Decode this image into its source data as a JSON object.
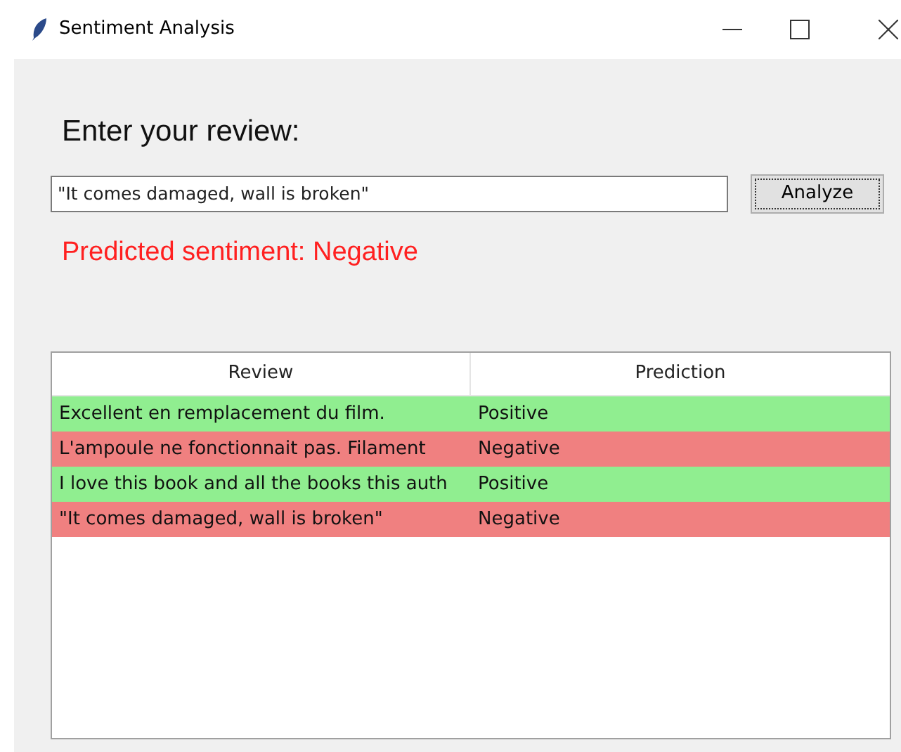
{
  "window": {
    "title": "Sentiment Analysis"
  },
  "prompt": "Enter your review:",
  "review_field": {
    "value": "\"It comes damaged, wall is broken\""
  },
  "analyze_button": "Analyze",
  "result": {
    "text": "Predicted sentiment: Negative",
    "color": "#ff2020"
  },
  "table": {
    "columns": [
      "Review",
      "Prediction"
    ],
    "rows": [
      {
        "cells": [
          "Excellent en remplacement du film.",
          "Positive"
        ],
        "color": "#90ee90"
      },
      {
        "cells": [
          "L'ampoule ne fonctionnait pas. Filament",
          "Negative"
        ],
        "color": "#f08080"
      },
      {
        "cells": [
          "I love this book and all the books this auth",
          "Positive"
        ],
        "color": "#90ee90"
      },
      {
        "cells": [
          "\"It comes damaged, wall is broken\"",
          "Negative"
        ],
        "color": "#f08080"
      }
    ]
  }
}
